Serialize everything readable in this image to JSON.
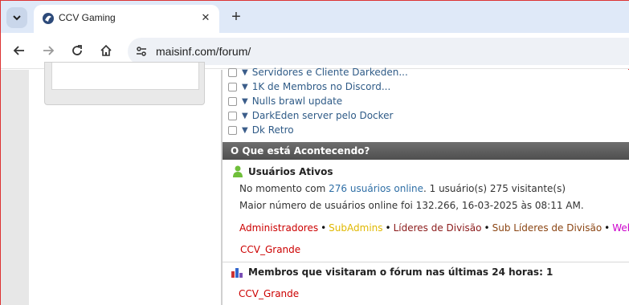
{
  "browser": {
    "tab_title": "CCV Gaming",
    "url": "maisinf.com/forum/"
  },
  "threads": [
    "Servidores e Cliente Darkeden...",
    "1K de Membros no Discord...",
    "Nulls brawl update",
    "DarkEden server pelo Docker",
    "Dk Retro"
  ],
  "whats_happening": {
    "header": "O Que está Acontecendo?",
    "active_title": "Usuários Ativos",
    "online_prefix": "No momento com ",
    "online_link": "276 usuários online",
    "online_suffix": ". 1 usuário(s) 275 visitante(s)",
    "record": "Maior número de usuários online foi 132.266, 16-03-2025 às 08:11 AM.",
    "legend": [
      {
        "label": "Administradores",
        "color": "#cc0000"
      },
      {
        "label": "SubAdmins",
        "color": "#e0b800"
      },
      {
        "label": "Líderes de Divisão",
        "color": "#8b1a1a"
      },
      {
        "label": "Sub Líderes de Divisão",
        "color": "#8b4513"
      },
      {
        "label": "Web Des",
        "color": "#cc00cc"
      }
    ],
    "online_user": "CCV_Grande",
    "visited_title": "Membros que visitaram o fórum nas últimas 24 horas: 1",
    "visited_user": "CCV_Grande"
  }
}
